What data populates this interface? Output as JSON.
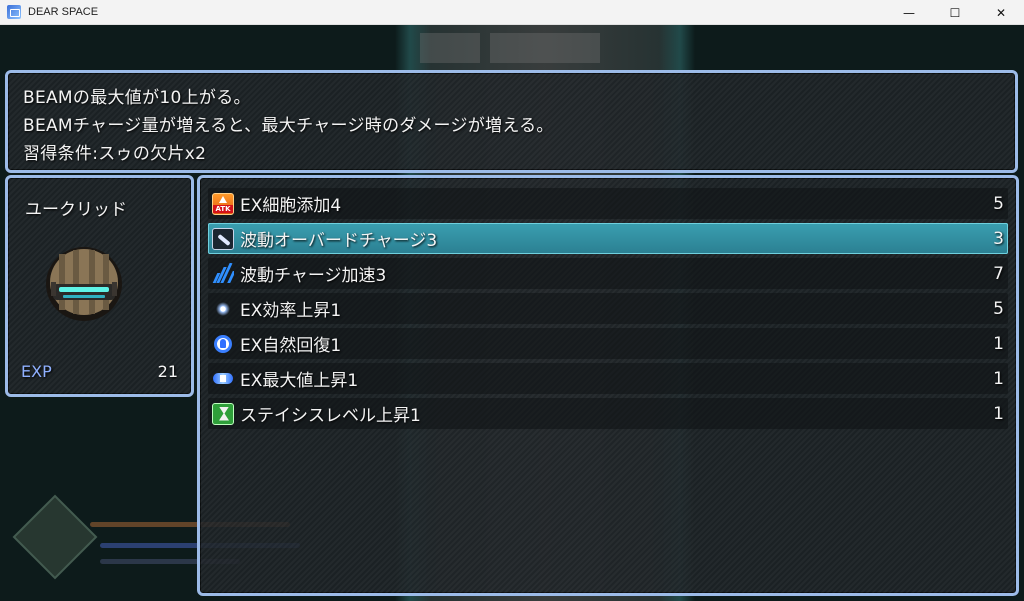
{
  "window": {
    "title": "DEAR SPACE",
    "minimize": "—",
    "maximize": "☐",
    "close": "✕"
  },
  "help": {
    "lines": [
      "BEAMの最大値が10上がる。",
      "BEAMチャージ量が増えると、最大チャージ時のダメージが増える。",
      "習得条件:スゥの欠片x2"
    ]
  },
  "status": {
    "actor_name": "ユークリッド",
    "exp_label": "EXP",
    "exp_value": "21"
  },
  "skills": [
    {
      "label": "EX細胞添加4",
      "value": "5",
      "icon": "atk-up-icon",
      "selected": false
    },
    {
      "label": "波動オーバードチャージ3",
      "value": "3",
      "icon": "wave-overcharge-icon",
      "selected": true
    },
    {
      "label": "波動チャージ加速3",
      "value": "7",
      "icon": "charge-speed-icon",
      "selected": false
    },
    {
      "label": "EX効率上昇1",
      "value": "5",
      "icon": "sparkle-icon",
      "selected": false
    },
    {
      "label": "EX自然回復1",
      "value": "1",
      "icon": "regen-icon",
      "selected": false
    },
    {
      "label": "EX最大値上昇1",
      "value": "1",
      "icon": "max-up-icon",
      "selected": false
    },
    {
      "label": "ステイシスレベル上昇1",
      "value": "1",
      "icon": "hourglass-icon",
      "selected": false
    }
  ],
  "icons": {
    "atk_text": "ATK"
  }
}
